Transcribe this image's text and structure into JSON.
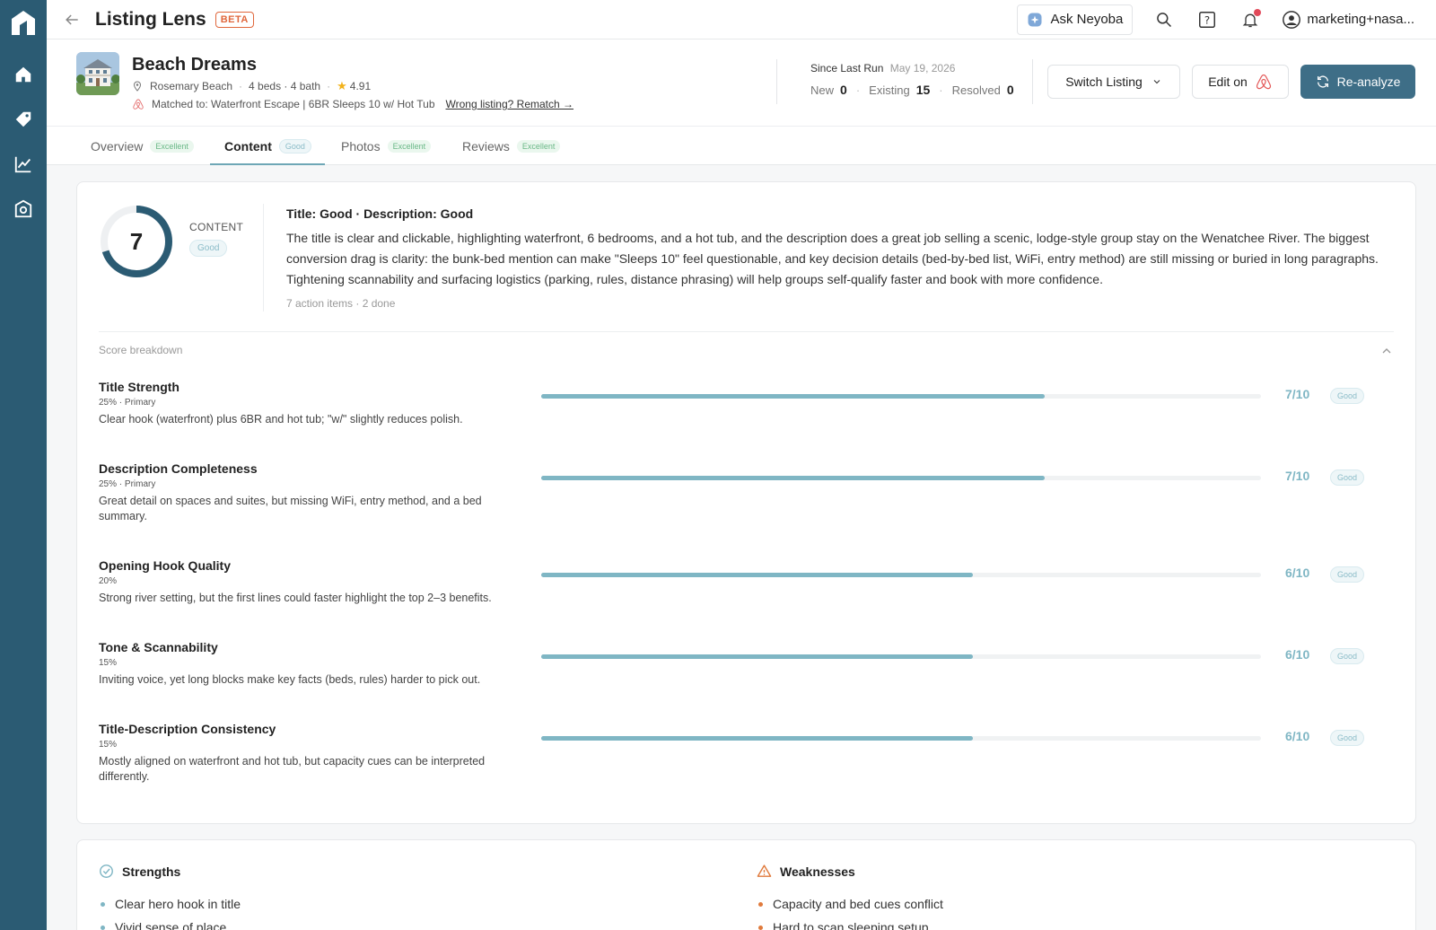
{
  "app": {
    "title": "Listing Lens",
    "badge": "BETA"
  },
  "topbar": {
    "ask_label": "Ask Neyoba",
    "account_label": "marketing+nasa..."
  },
  "listing": {
    "name": "Beach Dreams",
    "location": "Rosemary Beach",
    "beds_baths": "4 beds · 4 bath",
    "rating": "4.91",
    "matched": "Matched to: Waterfront Escape | 6BR Sleeps 10 w/ Hot Tub",
    "rematch": "Wrong listing? Rematch →"
  },
  "since_last_run": {
    "label": "Since Last Run",
    "date": "May 19, 2026",
    "new_label": "New",
    "new": "0",
    "existing_label": "Existing",
    "existing": "15",
    "resolved_label": "Resolved",
    "resolved": "0"
  },
  "actions": {
    "switch": "Switch Listing",
    "edit": "Edit on",
    "reanalyze": "Re-analyze"
  },
  "tabs": [
    {
      "label": "Overview",
      "badge": "Excellent"
    },
    {
      "label": "Content",
      "badge": "Good"
    },
    {
      "label": "Photos",
      "badge": "Excellent"
    },
    {
      "label": "Reviews",
      "badge": "Excellent"
    }
  ],
  "content": {
    "score": "7",
    "score_fraction": 0.7,
    "label": "CONTENT",
    "badge": "Good",
    "summary_title": "Title: Good · Description: Good",
    "summary": "The title is clear and clickable, highlighting waterfront, 6 bedrooms, and a hot tub, and the description does a great job selling a scenic, lodge-style group stay on the Wenatchee River. The biggest conversion drag is clarity: the bunk-bed mention can make \"Sleeps 10\" feel questionable, and key decision details (bed-by-bed list, WiFi, entry method) are still missing or buried in long paragraphs. Tightening scannability and surfacing logistics (parking, rules, distance phrasing) will help groups self-qualify faster and book with more confidence.",
    "meta": "7 action items · 2 done",
    "breakdown_label": "Score breakdown"
  },
  "criteria": [
    {
      "name": "Title Strength",
      "weight": "25% · Primary",
      "desc": "Clear hook (waterfront) plus 6BR and hot tub; \"w/\" slightly reduces polish.",
      "score": "7/10",
      "value": 7,
      "badge": "Good"
    },
    {
      "name": "Description Completeness",
      "weight": "25% · Primary",
      "desc": "Great detail on spaces and suites, but missing WiFi, entry method, and a bed summary.",
      "score": "7/10",
      "value": 7,
      "badge": "Good"
    },
    {
      "name": "Opening Hook Quality",
      "weight": "20%",
      "desc": "Strong river setting, but the first lines could faster highlight the top 2–3 benefits.",
      "score": "6/10",
      "value": 6,
      "badge": "Good"
    },
    {
      "name": "Tone & Scannability",
      "weight": "15%",
      "desc": "Inviting voice, yet long blocks make key facts (beds, rules) harder to pick out.",
      "score": "6/10",
      "value": 6,
      "badge": "Good"
    },
    {
      "name": "Title-Description Consistency",
      "weight": "15%",
      "desc": "Mostly aligned on waterfront and hot tub, but capacity cues can be interpreted differently.",
      "score": "6/10",
      "value": 6,
      "badge": "Good"
    }
  ],
  "strengths": {
    "title": "Strengths",
    "items": [
      "Clear hero hook in title",
      "Vivid sense of place"
    ]
  },
  "weaknesses": {
    "title": "Weaknesses",
    "items": [
      "Capacity and bed cues conflict",
      "Hard to scan sleeping setup"
    ]
  },
  "colors": {
    "sidebar": "#2b5b73",
    "primary": "#3e6e87",
    "accent": "#7fb6c4",
    "beta": "#e0673c",
    "strength": "#7fb6c4",
    "weakness": "#e07a3c"
  }
}
